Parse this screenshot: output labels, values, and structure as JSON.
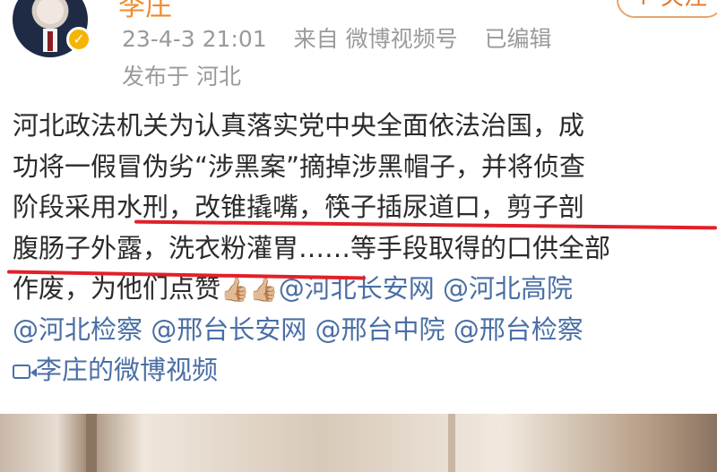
{
  "user": {
    "name": "李庄",
    "follow_label": "+ 关注"
  },
  "meta": {
    "time": "23-4-3 21:01",
    "source": "来自 微博视频号",
    "edited": "已编辑",
    "location": "发布于 河北"
  },
  "post": {
    "line1": "河北政法机关为认真落实党中央全面依法治国，成",
    "line2": "功将一假冒伪劣“涉黑案”摘掉涉黑帽子，并将侦查",
    "line3": "阶段采用水刑，改锥撬嘴，筷子插尿道口，剪子剖",
    "line4": "腹肠子外露，洗衣粉灌胃……等手段取得的口供全部",
    "line5_text": "作废，为他们点赞",
    "thumbs": "👍🏼👍🏼",
    "mentions": [
      "@河北长安网",
      "@河北高院",
      "@河北检察",
      "@邢台长安网",
      "@邢台中院",
      "@邢台检察"
    ],
    "video_link": "李庄的微博视频"
  },
  "colors": {
    "accent": "#f08a2b",
    "link": "#4a6fa5",
    "meta": "#9a9a9a",
    "underline": "#e2202a"
  }
}
